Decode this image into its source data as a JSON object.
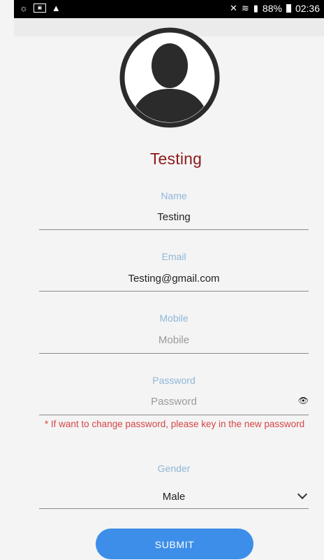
{
  "status_bar": {
    "battery_percent": "88%",
    "time": "02:36",
    "icons": [
      "brightness-icon",
      "notification-box-icon",
      "warning-icon",
      "mute-icon",
      "wifi-icon",
      "signal-icon",
      "battery-icon"
    ]
  },
  "profile": {
    "name": "Testing",
    "avatar_icon": "default-user-avatar-icon"
  },
  "form": {
    "name": {
      "label": "Name",
      "value": "Testing"
    },
    "email": {
      "label": "Email",
      "value": "Testing@gmail.com"
    },
    "mobile": {
      "label": "Mobile",
      "placeholder": "Mobile",
      "value": ""
    },
    "password": {
      "label": "Password",
      "placeholder": "Password",
      "value": "",
      "toggle_icon": "eye-icon"
    },
    "password_note": "* If want to change password, please key in the new password",
    "gender": {
      "label": "Gender",
      "selected": "Male",
      "icon": "chevron-down-icon"
    },
    "submit_label": "SUBMIT"
  },
  "colors": {
    "title": "#8b1a1a",
    "label": "#8fb7d8",
    "note": "#d64545",
    "button": "#3d8ee8"
  }
}
